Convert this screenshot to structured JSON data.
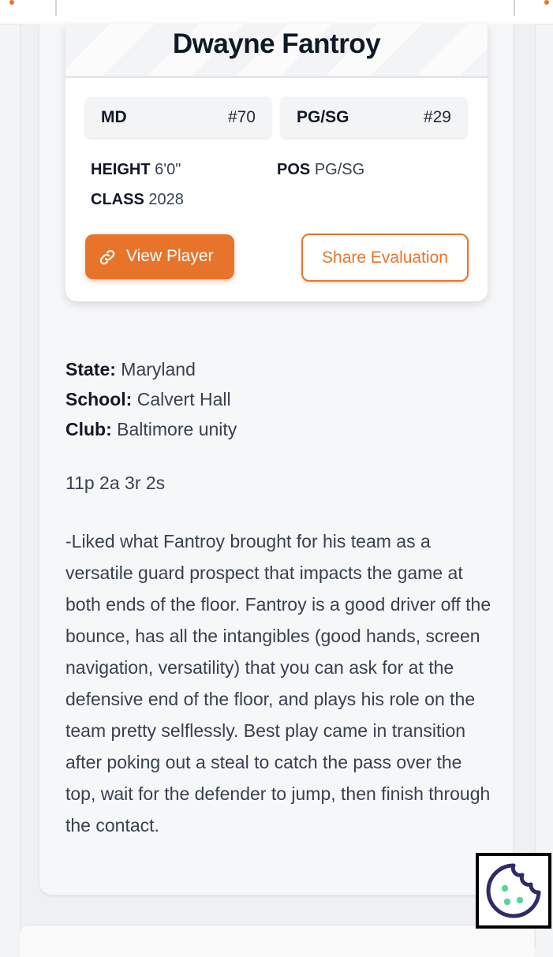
{
  "player": {
    "name": "Dwayne Fantroy",
    "badges": [
      {
        "left": "MD",
        "right": "#70"
      },
      {
        "left": "PG/SG",
        "right": "#29"
      }
    ],
    "height_label": "HEIGHT",
    "height_value": "6'0\"",
    "class_label": "CLASS",
    "class_value": "2028",
    "pos_label": "POS",
    "pos_value": "PG/SG",
    "view_button": "View Player",
    "share_button": "Share Evaluation"
  },
  "details": {
    "state_label": "State:",
    "state_value": "Maryland",
    "school_label": "School:",
    "school_value": "Calvert Hall",
    "club_label": "Club:",
    "club_value": "Baltimore unity"
  },
  "stats": "11p 2a 3r 2s",
  "evaluation": "-Liked what Fantroy brought for his team as a versatile guard prospect that impacts the game at both ends of the floor. Fantroy is a good driver off the bounce, has all the intangibles (good hands, screen navigation, versatility) that you can ask for at the defensive end of the floor, and plays his role on the team pretty selflessly. Best play came in transition after poking out a steal to catch the pass over the top, wait for the defender to jump, then finish through the contact.",
  "icons": {
    "link": "link-icon",
    "cookie": "cookie-icon"
  },
  "colors": {
    "accent": "#e8742c",
    "cookie": "#2e2a6b",
    "cookie_dots": "#5fd29a"
  }
}
